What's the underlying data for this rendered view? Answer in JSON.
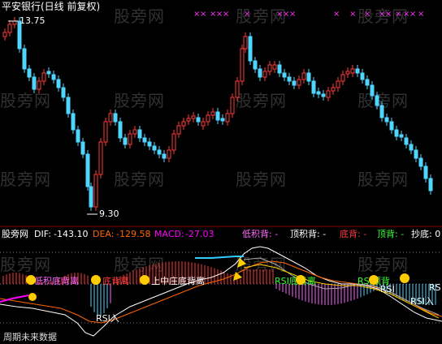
{
  "main_panel": {
    "title": "平安银行(日线 前复权)",
    "high_label": "13.75",
    "low_label": "9.30"
  },
  "indicator_panel": {
    "site": "股旁网",
    "dif_label": "DIF:",
    "dif_value": "-143.10",
    "dea_label": "DEA:",
    "dea_value": "-129.58",
    "macd_label": "MACD:",
    "macd_value": "-27.03",
    "low_div": "低积背: -",
    "top_div": "顶积背: -",
    "bottom_back": "底背: -",
    "top_back": "顶背: -",
    "chaodi": "抄底: 0",
    "signals": {
      "s1": "低积底背离",
      "s2": "底背离",
      "s3": "上中庄底背离",
      "s4": "RSI底背离",
      "s5": "RSI顶背",
      "s6": "RSI入",
      "s7": "RSI入",
      "s8": "RSI",
      "s9": "RS"
    },
    "footer": "周期未来数据"
  },
  "watermark": "股旁网",
  "colors": {
    "up": "#ff3b3b",
    "down": "#4fd6ff",
    "dif": "#ffffff",
    "dea": "#ffcc00",
    "macd": "#ff00ff",
    "grid": "#8b0000"
  }
}
